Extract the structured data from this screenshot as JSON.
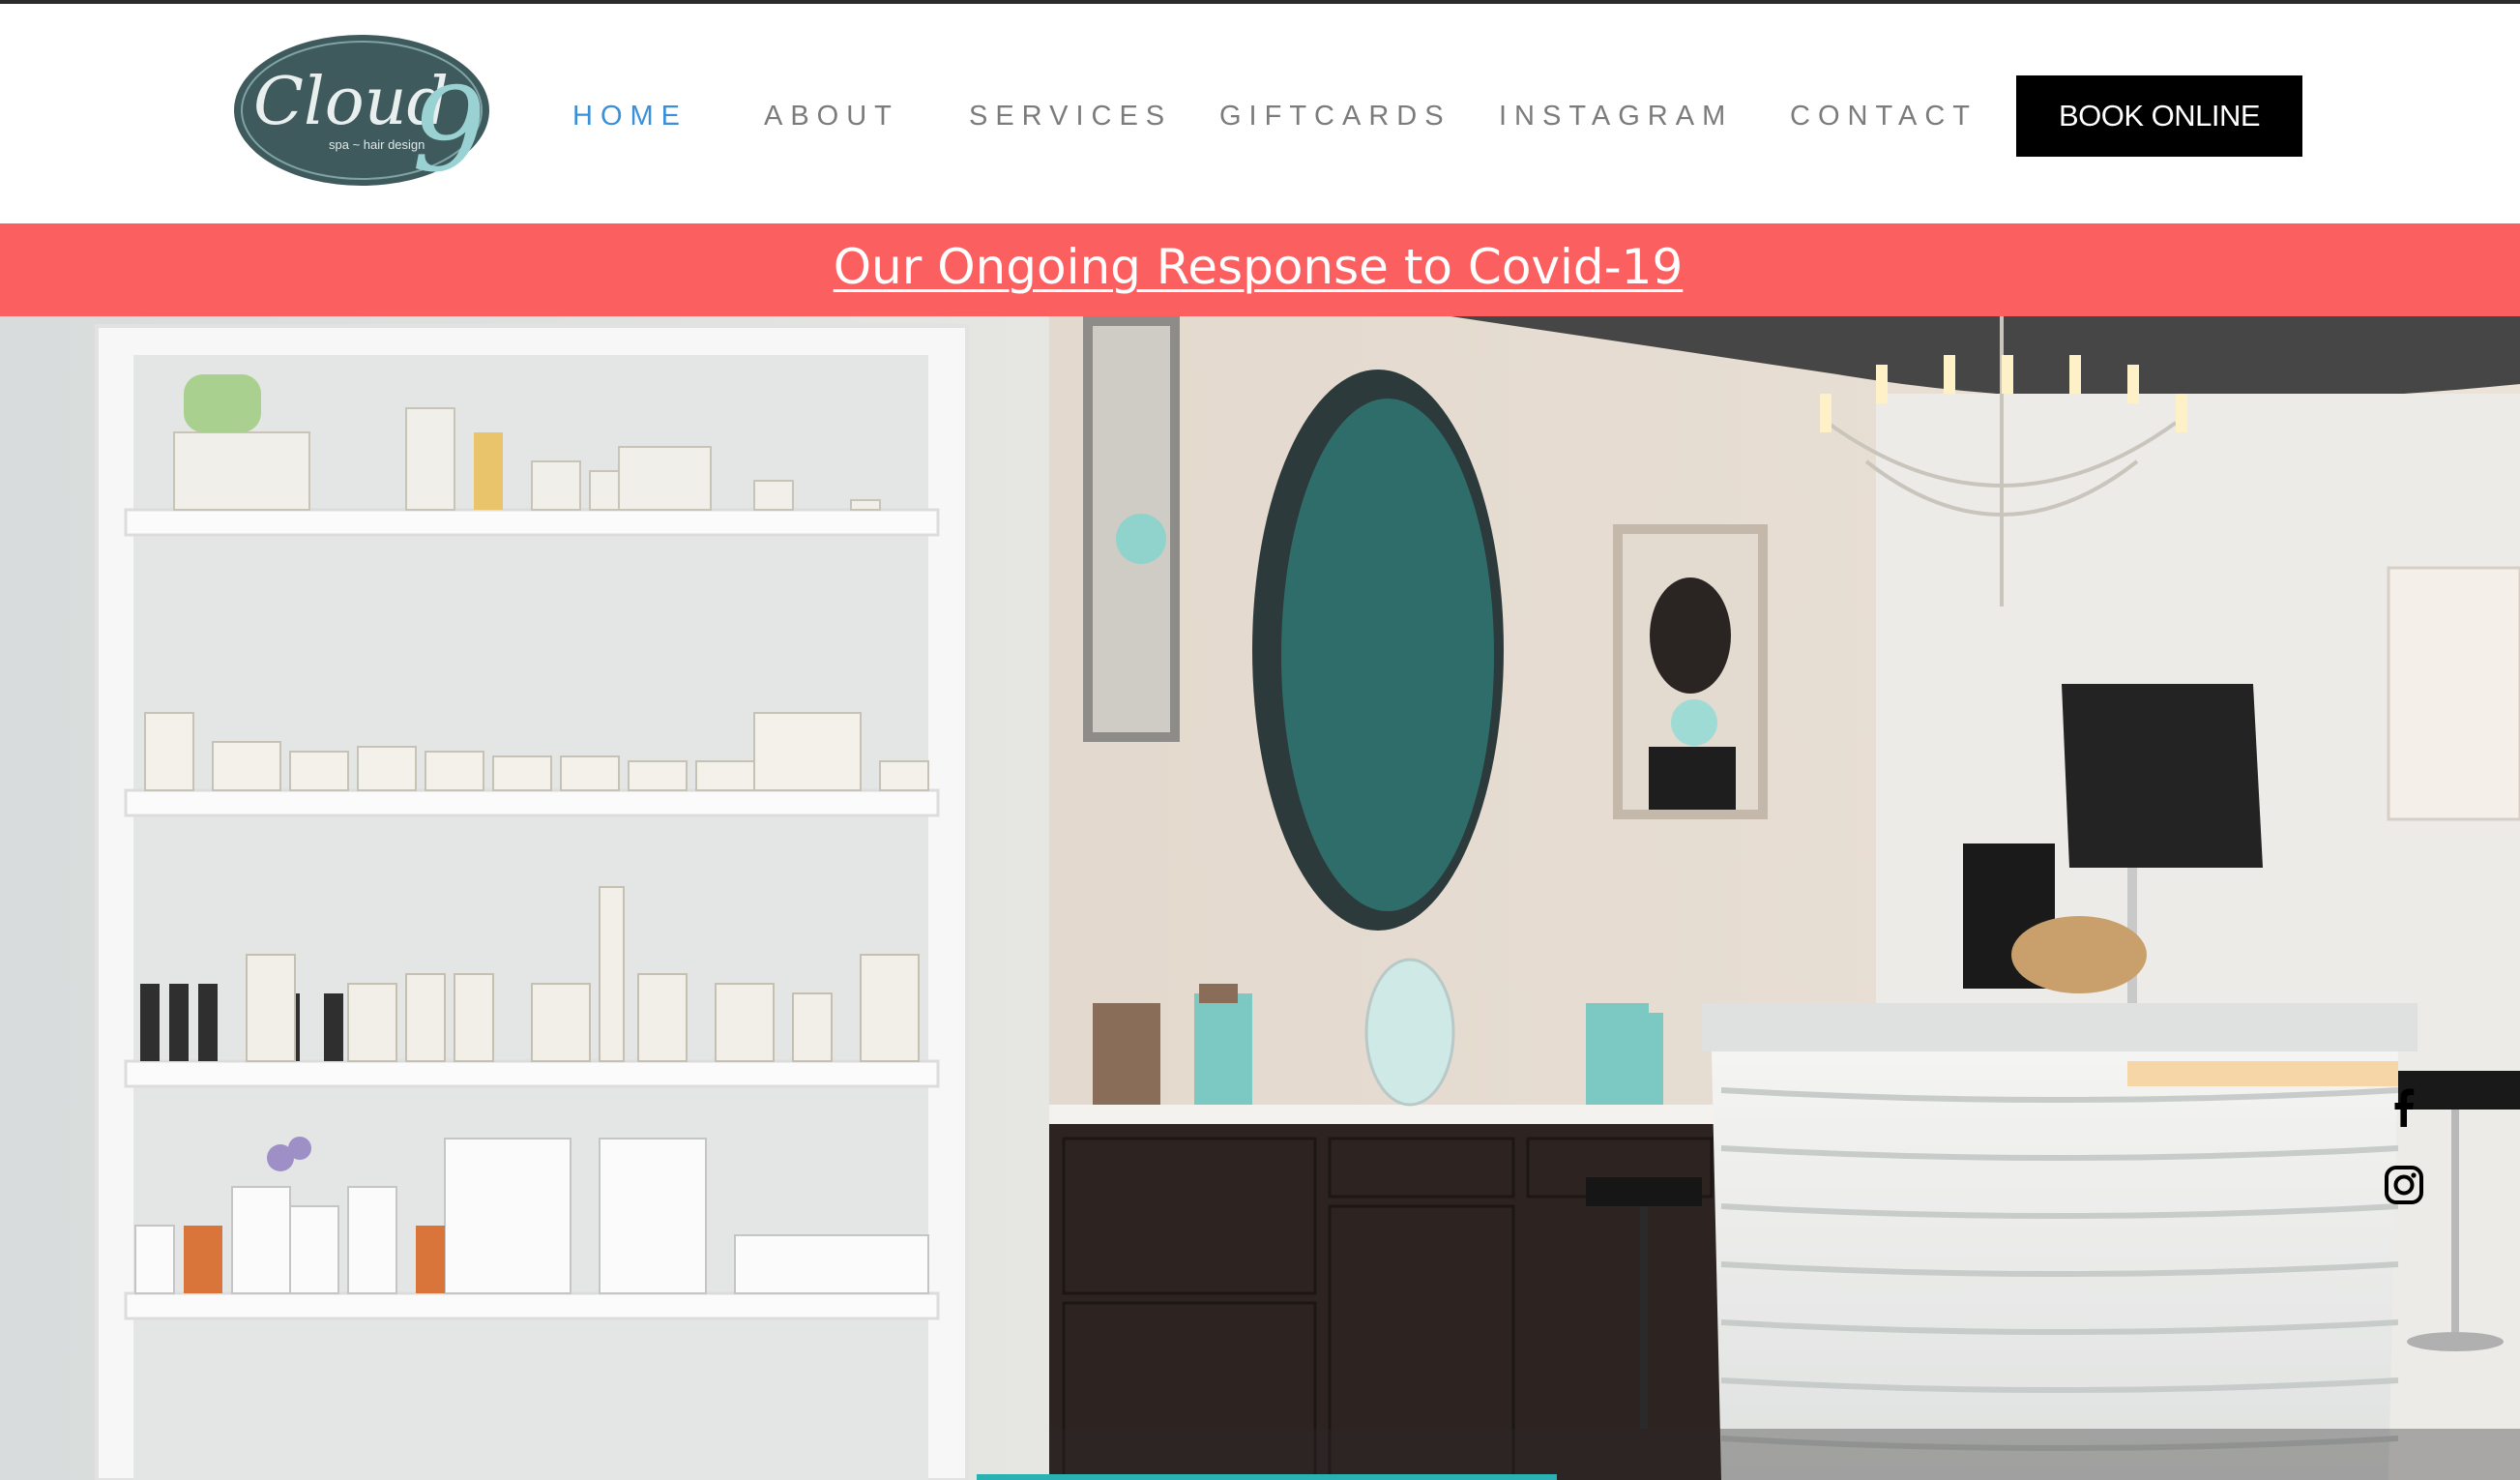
{
  "logo": {
    "wordmark": "Cloud",
    "numeral": "9",
    "tagline": "spa ~ hair design"
  },
  "nav": {
    "items": [
      {
        "label": "HOME",
        "active": true
      },
      {
        "label": "ABOUT",
        "active": false
      },
      {
        "label": "SERVICES",
        "active": false
      },
      {
        "label": "GIFTCARDS",
        "active": false
      },
      {
        "label": "INSTAGRAM",
        "active": false
      },
      {
        "label": "CONTACT",
        "active": false
      }
    ],
    "book_label": "BOOK ONLINE"
  },
  "banner": {
    "text": "Our Ongoing Response to Covid-19",
    "color": "#fb5f5f"
  },
  "social": {
    "icons": [
      "facebook-icon",
      "instagram-icon"
    ]
  },
  "colors": {
    "nav_active": "#3a8fd9",
    "nav_text": "#7b7b7b",
    "button_bg": "#000000",
    "accent_teal": "#29b1b4"
  }
}
